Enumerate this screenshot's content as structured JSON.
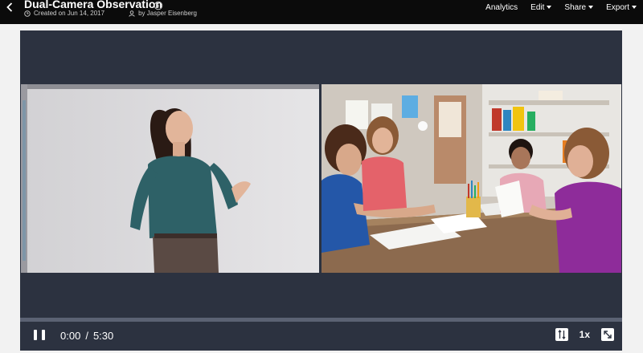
{
  "header": {
    "title": "Dual-Camera Observation",
    "created": "Created on Jun 14, 2017",
    "author": "by Jasper Eisenberg",
    "actions": [
      {
        "label": "Analytics",
        "dropdown": false
      },
      {
        "label": "Edit",
        "dropdown": true
      },
      {
        "label": "Share",
        "dropdown": true
      },
      {
        "label": "Export",
        "dropdown": true
      }
    ]
  },
  "player": {
    "current_time": "0:00",
    "separator": "/",
    "duration": "5:30",
    "speed": "1x",
    "progress_fraction": 0.0,
    "left_camera": "teacher-camera",
    "right_camera": "students-camera"
  },
  "colors": {
    "topbar_bg": "#0b0b0b",
    "player_bg": "#2c3240",
    "progress_track": "#5b6273"
  }
}
